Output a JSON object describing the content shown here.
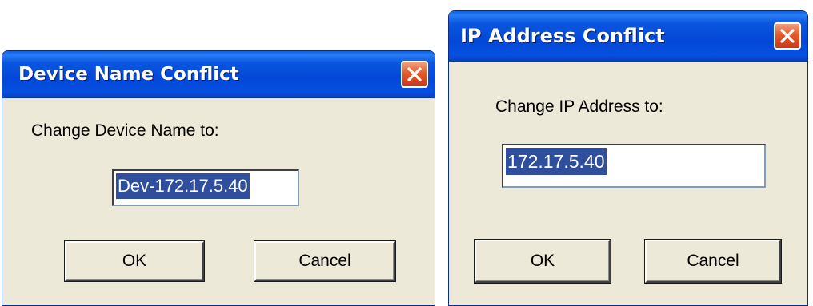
{
  "device_dialog": {
    "title": "Device Name Conflict",
    "prompt": "Change Device Name to:",
    "field_value": "Dev-172.17.5.40",
    "ok_label": "OK",
    "cancel_label": "Cancel",
    "close_icon": "close-icon"
  },
  "ip_dialog": {
    "title": "IP Address Conflict",
    "prompt": "Change IP Address to:",
    "field_value": "172.17.5.40",
    "ok_label": "OK",
    "cancel_label": "Cancel",
    "close_icon": "close-icon"
  },
  "colors": {
    "titlebar": "#0347d8",
    "dialog_background": "#ece9d8",
    "close_button": "#e55a2a",
    "selection": "#2f4f9e"
  }
}
